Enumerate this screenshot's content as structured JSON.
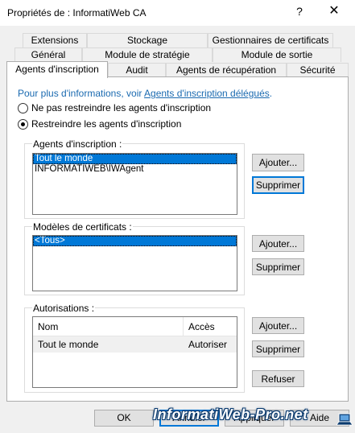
{
  "window": {
    "title": "Propriétés de : InformatiWeb CA",
    "help_glyph": "?",
    "close_glyph": "✕"
  },
  "tabs": {
    "row1": [
      "Extensions",
      "Stockage",
      "Gestionnaires de certificats"
    ],
    "row2": [
      "Général",
      "Module de stratégie",
      "Module de sortie"
    ],
    "row3": [
      "Agents d'inscription",
      "Audit",
      "Agents de récupération",
      "Sécurité"
    ],
    "active": "Agents d'inscription"
  },
  "info": {
    "prefix": "Pour plus d'informations, voir ",
    "link": "Agents d'inscription délégués",
    "suffix": "."
  },
  "radios": [
    {
      "label": "Ne pas restreindre les agents d'inscription",
      "checked": false
    },
    {
      "label": "Restreindre les agents d'inscription",
      "checked": true
    }
  ],
  "agents": {
    "label": "Agents d'inscription :",
    "items": [
      "Tout le monde",
      "INFORMATIWEB\\IWAgent"
    ],
    "selected_index": 0,
    "add_label": "Ajouter...",
    "remove_label": "Supprimer"
  },
  "templates": {
    "label": "Modèles de certificats :",
    "items": [
      "<Tous>"
    ],
    "selected_index": 0,
    "add_label": "Ajouter...",
    "remove_label": "Supprimer"
  },
  "permissions": {
    "label": "Autorisations :",
    "col_name": "Nom",
    "col_access": "Accès",
    "rows": [
      {
        "name": "Tout le monde",
        "access": "Autoriser"
      }
    ],
    "add_label": "Ajouter...",
    "remove_label": "Supprimer",
    "deny_label": "Refuser"
  },
  "footer": {
    "ok": "OK",
    "cancel": "Annuler",
    "apply": "Appliquer",
    "help": "Aide"
  },
  "watermark": "InformatiWeb-Pro.net",
  "colors": {
    "selection": "#0078d7",
    "link": "#1a6ab0",
    "dialog_bg": "#f0f0f0"
  }
}
